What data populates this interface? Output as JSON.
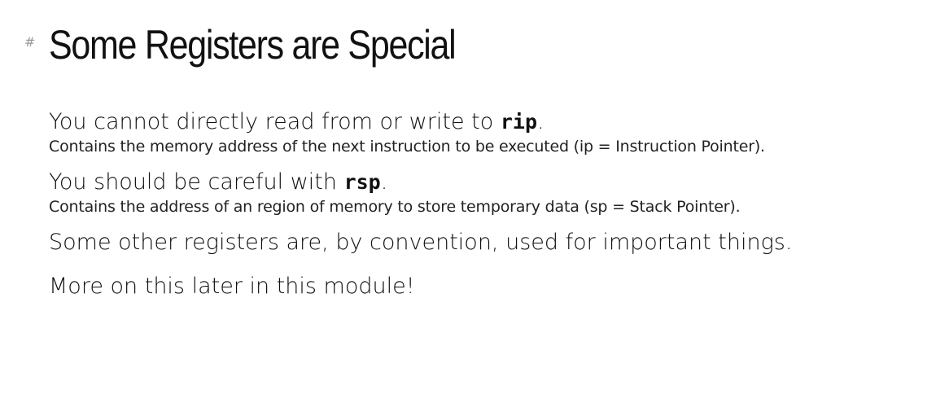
{
  "heading": {
    "anchor": "#",
    "title": "Some Registers are Special"
  },
  "items": [
    {
      "lead_before": "You cannot directly read from or write to ",
      "code": "rip",
      "lead_after": ".",
      "detail": "Contains the memory address of the next instruction to be executed (ip = Instruction Pointer)."
    },
    {
      "lead_before": "You should be careful with ",
      "code": "rsp",
      "lead_after": ".",
      "detail": "Contains the address of an region of memory to store temporary data (sp = Stack Pointer)."
    }
  ],
  "paragraphs": [
    "Some other registers are, by convention, used for important things.",
    "More on this later in this module!"
  ]
}
